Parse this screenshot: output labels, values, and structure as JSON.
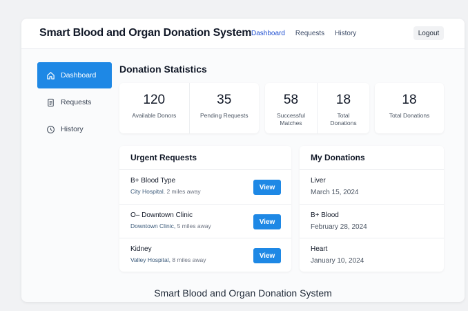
{
  "header": {
    "title": "Smart Blood and Organ Donation System",
    "nav": [
      "Dashboard",
      "Requests",
      "History"
    ],
    "logout": "Logout"
  },
  "sidebar": {
    "items": [
      {
        "label": "Dashboard",
        "icon": "home-icon",
        "active": true
      },
      {
        "label": "Requests",
        "icon": "document-icon",
        "active": false
      },
      {
        "label": "History",
        "icon": "clock-icon",
        "active": false
      }
    ]
  },
  "stats": {
    "title": "Donation Statistics",
    "items": [
      {
        "value": "120",
        "label": "Available Donors"
      },
      {
        "value": "35",
        "label": "Pending Requests"
      },
      {
        "value": "58",
        "label": "Successful\nMatches"
      },
      {
        "value": "18",
        "label": "Total\nDonations"
      },
      {
        "value": "18",
        "label": "Total Donations"
      }
    ]
  },
  "urgent": {
    "title": "Urgent Requests",
    "button_label": "View",
    "items": [
      {
        "name": "B+ Blood Type",
        "place": "City Hospital.",
        "distance": "2 miles away"
      },
      {
        "name": "O– Downtown Clinic",
        "place": "Downtown Clinic,",
        "distance": "5 miles away"
      },
      {
        "name": "Kidney",
        "place": "Valley Hospital,",
        "distance": "8 miles away"
      }
    ]
  },
  "donations": {
    "title": "My Donations",
    "items": [
      {
        "name": "Liver",
        "date": "March 15, 2024"
      },
      {
        "name": "B+ Blood",
        "date": "February 28, 2024"
      },
      {
        "name": "Heart",
        "date": "January 10, 2024"
      }
    ]
  },
  "footer": "Smart Blood and Organ Donation System",
  "colors": {
    "accent": "#1e88e5",
    "nav_active": "#1f4fd1",
    "background": "#f1f2f4"
  }
}
